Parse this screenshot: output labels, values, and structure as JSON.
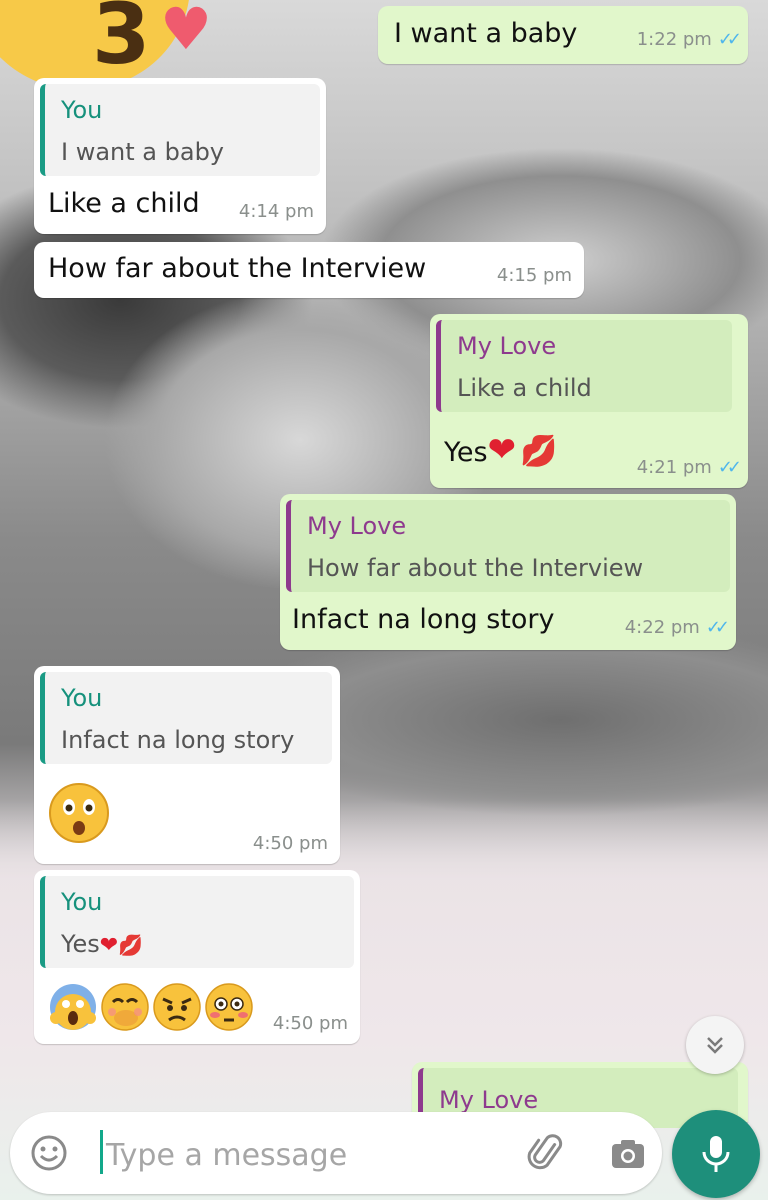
{
  "conversation": {
    "messages": [
      {
        "text": "I want a baby",
        "time": "1:22 pm",
        "direction": "out"
      },
      {
        "quote_author": "You",
        "quote_text": "I want a baby",
        "text": "Like a child",
        "time": "4:14 pm",
        "direction": "in"
      },
      {
        "text": "How far about the Interview",
        "time": "4:15 pm",
        "direction": "in"
      },
      {
        "quote_author": "My Love",
        "quote_text": "Like a child",
        "text": "Yes",
        "emojis": [
          "red-heart",
          "kiss-mark"
        ],
        "time": "4:21 pm",
        "direction": "out"
      },
      {
        "quote_author": "My Love",
        "quote_text": "How far about the Interview",
        "text": "Infact na long story",
        "time": "4:22 pm",
        "direction": "out"
      },
      {
        "quote_author": "You",
        "quote_text": "Infact na long story",
        "emojis": [
          "astonished-face"
        ],
        "time": "4:50 pm",
        "direction": "in"
      },
      {
        "quote_author": "You",
        "quote_text": "Yes",
        "quote_emojis": [
          "red-heart",
          "kiss-mark"
        ],
        "emojis": [
          "screaming-face",
          "face-with-hand-over-mouth",
          "worried-face",
          "flushed-face"
        ],
        "time": "4:50 pm",
        "direction": "in"
      },
      {
        "quote_author": "My Love",
        "direction": "out",
        "partial": true
      }
    ]
  },
  "composer": {
    "placeholder": "Type a message"
  },
  "icons": {
    "emoji": "smiley-icon",
    "attach": "paperclip-icon",
    "camera": "camera-icon",
    "mic": "microphone-icon",
    "scroll": "chevron-double-down-icon",
    "read_receipt": "double-check-icon"
  },
  "colors": {
    "outgoing_bubble": "#e1f7cb",
    "incoming_bubble": "#ffffff",
    "incoming_quote_bar": "#1a9b85",
    "outgoing_quote_bar": "#8e3a8e",
    "read_ticks": "#4fb6ec",
    "mic_button": "#1e8f7b"
  }
}
